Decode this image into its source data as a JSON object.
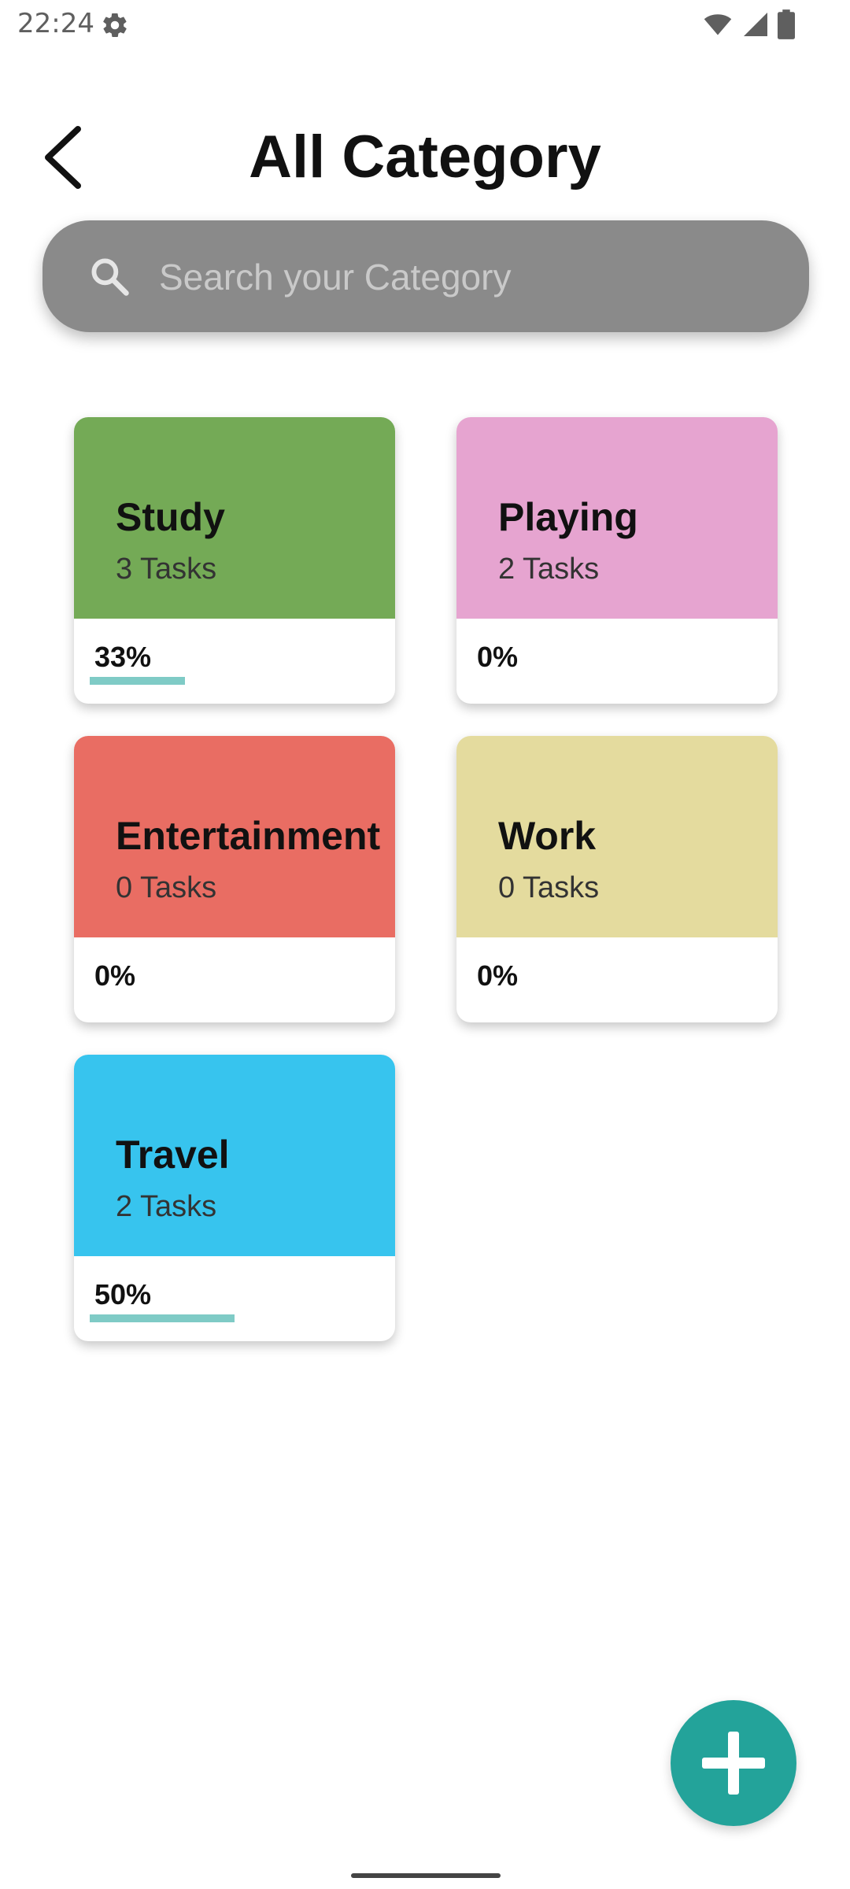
{
  "status_bar": {
    "time": "22:24",
    "icons": [
      "gear-icon",
      "wifi-icon",
      "signal-icon",
      "battery-icon"
    ]
  },
  "header": {
    "title": "All Category",
    "back_icon": "chevron-left-icon"
  },
  "search": {
    "placeholder": "Search your Category",
    "value": "",
    "icon": "search-icon"
  },
  "categories": [
    {
      "name": "Study",
      "tasks": "3 Tasks",
      "percent": "33%",
      "progress": 0.33,
      "color": "#74aa56"
    },
    {
      "name": "Playing",
      "tasks": "2 Tasks",
      "percent": "0%",
      "progress": 0.0,
      "color": "#e6a4d0"
    },
    {
      "name": "Entertainment",
      "tasks": "0 Tasks",
      "percent": "0%",
      "progress": 0.0,
      "color": "#e96d63"
    },
    {
      "name": "Work",
      "tasks": "0 Tasks",
      "percent": "0%",
      "progress": 0.0,
      "color": "#e4db9e"
    },
    {
      "name": "Travel",
      "tasks": "2 Tasks",
      "percent": "50%",
      "progress": 0.5,
      "color": "#37c4ee"
    }
  ],
  "colors": {
    "progress": "#7fcbc6",
    "fab": "#23a39a",
    "search_bg": "#8a8a8a"
  },
  "fab": {
    "icon": "plus-icon"
  }
}
